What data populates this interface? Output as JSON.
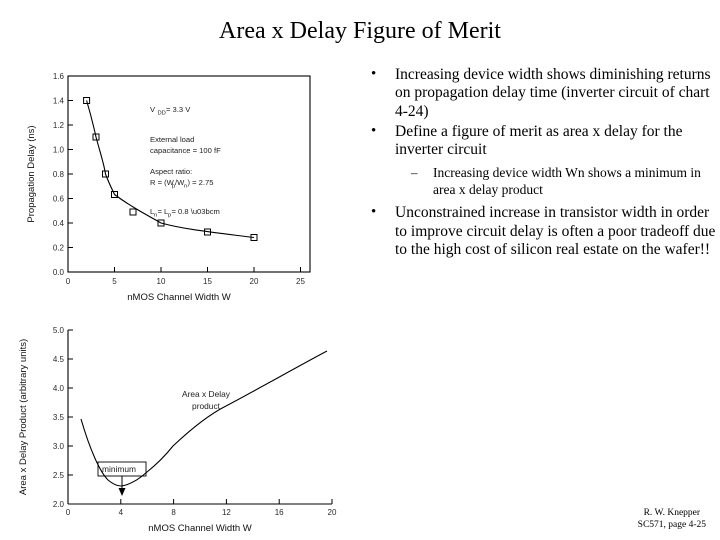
{
  "slide": {
    "title": "Area x Delay Figure of Merit",
    "bullets": [
      {
        "marker": "•",
        "text": "Increasing device width shows diminishing returns on propagation delay time (inverter circuit of chart 4-24)"
      },
      {
        "marker": "•",
        "text": "Define a figure of merit as area x delay for the inverter circuit"
      }
    ],
    "subbullets": [
      {
        "marker": "–",
        "text": "Increasing device width Wn shows a minimum in area x delay product"
      }
    ],
    "bullets2": [
      {
        "marker": "•",
        "text": "Unconstrained increase in transistor width in order to improve circuit delay is often a poor tradeoff due to the high cost of silicon real estate on the wafer!!"
      }
    ],
    "footer": {
      "line1": "R. W. Knepper",
      "line2": "SC571, page 4-25"
    }
  },
  "chart_data": [
    {
      "type": "line",
      "id": "propagation-delay-chart",
      "title": "",
      "xlabel": "nMOS Channel Width  Wₙ  (μm)",
      "ylabel": "Propagation Delay  (ns)",
      "xticks": [
        0,
        5,
        10,
        15,
        20,
        25
      ],
      "yticks": [
        0.0,
        0.2,
        0.4,
        0.6,
        0.8,
        1.0,
        1.2,
        1.4,
        1.6
      ],
      "xlim": [
        0,
        26
      ],
      "ylim": [
        0,
        1.7
      ],
      "grid": false,
      "x": [
        2,
        3,
        4,
        5,
        7,
        10,
        15,
        20
      ],
      "values": [
        1.4,
        1.0,
        0.8,
        0.64,
        0.49,
        0.4,
        0.33,
        0.29
      ],
      "annotations": [
        "Vₑₑ = 3.3 V",
        "External load",
        "capacitance = 100 fF",
        "Aspect ratio:",
        "R = (Wₚ/Wₙ) = 2.75",
        "Lₙ = Lₚ = 0.8 μm"
      ]
    },
    {
      "type": "line",
      "id": "area-delay-product-chart",
      "title": "",
      "xlabel": "nMOS Channel Width  Wₙ  (μm)",
      "ylabel": "Area x Delay Product  (arbitrary units)",
      "xticks": [
        0,
        4,
        8,
        12,
        16,
        20
      ],
      "yticks": [
        2.0,
        2.5,
        3.0,
        3.5,
        4.0,
        4.5,
        5.0
      ],
      "xlim": [
        0,
        21
      ],
      "ylim": [
        2.0,
        5.2
      ],
      "grid": false,
      "x": [
        1,
        2,
        3,
        4,
        5,
        6,
        8,
        12,
        16,
        20
      ],
      "values": [
        3.45,
        2.75,
        2.4,
        2.3,
        2.45,
        2.6,
        3.0,
        3.6,
        4.1,
        4.6
      ],
      "annotations": [
        "Area x Delay",
        "product",
        "minimum"
      ]
    }
  ]
}
